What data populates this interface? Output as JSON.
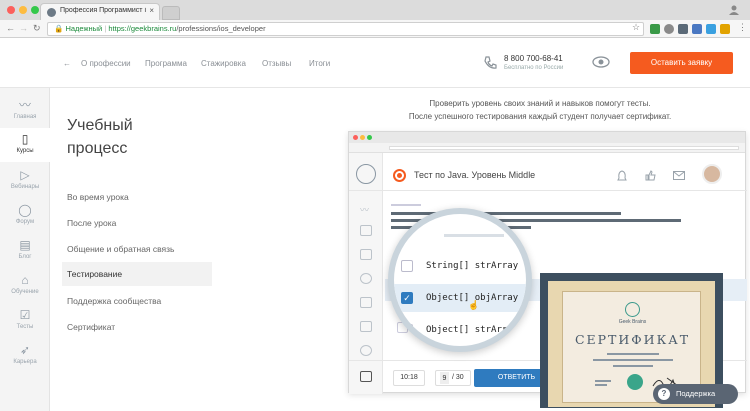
{
  "browser": {
    "tab_title": "Профессия Программист iOS",
    "tab_close": "×",
    "secure_label": "Надежный",
    "url_host": "https://geekbrains.ru",
    "url_path": "/professions/ios_developer"
  },
  "sidebar": {
    "items": [
      {
        "label": "Главная",
        "icon": "pulse-icon"
      },
      {
        "label": "Курсы",
        "icon": "book-icon"
      },
      {
        "label": "Вебинары",
        "icon": "video-icon"
      },
      {
        "label": "Форум",
        "icon": "chat-icon"
      },
      {
        "label": "Блог",
        "icon": "news-icon"
      },
      {
        "label": "Обучение",
        "icon": "graduation-cap-icon"
      },
      {
        "label": "Тесты",
        "icon": "checkbox-icon"
      },
      {
        "label": "Карьера",
        "icon": "rocket-icon"
      }
    ]
  },
  "header": {
    "back_arrow": "←",
    "nav": [
      "О профессии",
      "Программа",
      "Стажировка",
      "Отзывы",
      "Итоги"
    ],
    "phone": "8 800 700-68-41",
    "phone_note": "Бесплатно по России",
    "cta": "Оставить заявку"
  },
  "main": {
    "title": "Учебный процесс",
    "menu": [
      "Во время урока",
      "После урока",
      "Общение и обратная связь",
      "Тестирование",
      "Поддержка сообщества",
      "Сертификат"
    ],
    "active_index": 3,
    "intro_line1": "Проверить уровень своих знаний и навыков помогут тесты.",
    "intro_line2": "После успешного тестирования каждый студент получает сертификат."
  },
  "mock": {
    "test_title": "Тест по Java. Уровень Middle",
    "options": [
      "String[] strArray",
      "Object[] objArray",
      "Object[] strArray"
    ],
    "time": "10:18",
    "progress_current": "9",
    "progress_total": "/ 30",
    "answer_button": "ОТВЕТИТЬ",
    "certificate_title": "СЕРТИФИКАТ",
    "certificate_brand": "Geek Brains"
  },
  "support": {
    "label": "Поддержка",
    "icon_glyph": "?"
  },
  "colors": {
    "accent": "#f55b1f",
    "sidebar_icon": "#8d98a3",
    "answer_blue": "#2f7bbf",
    "cert_frame": "#3d4f5f"
  }
}
